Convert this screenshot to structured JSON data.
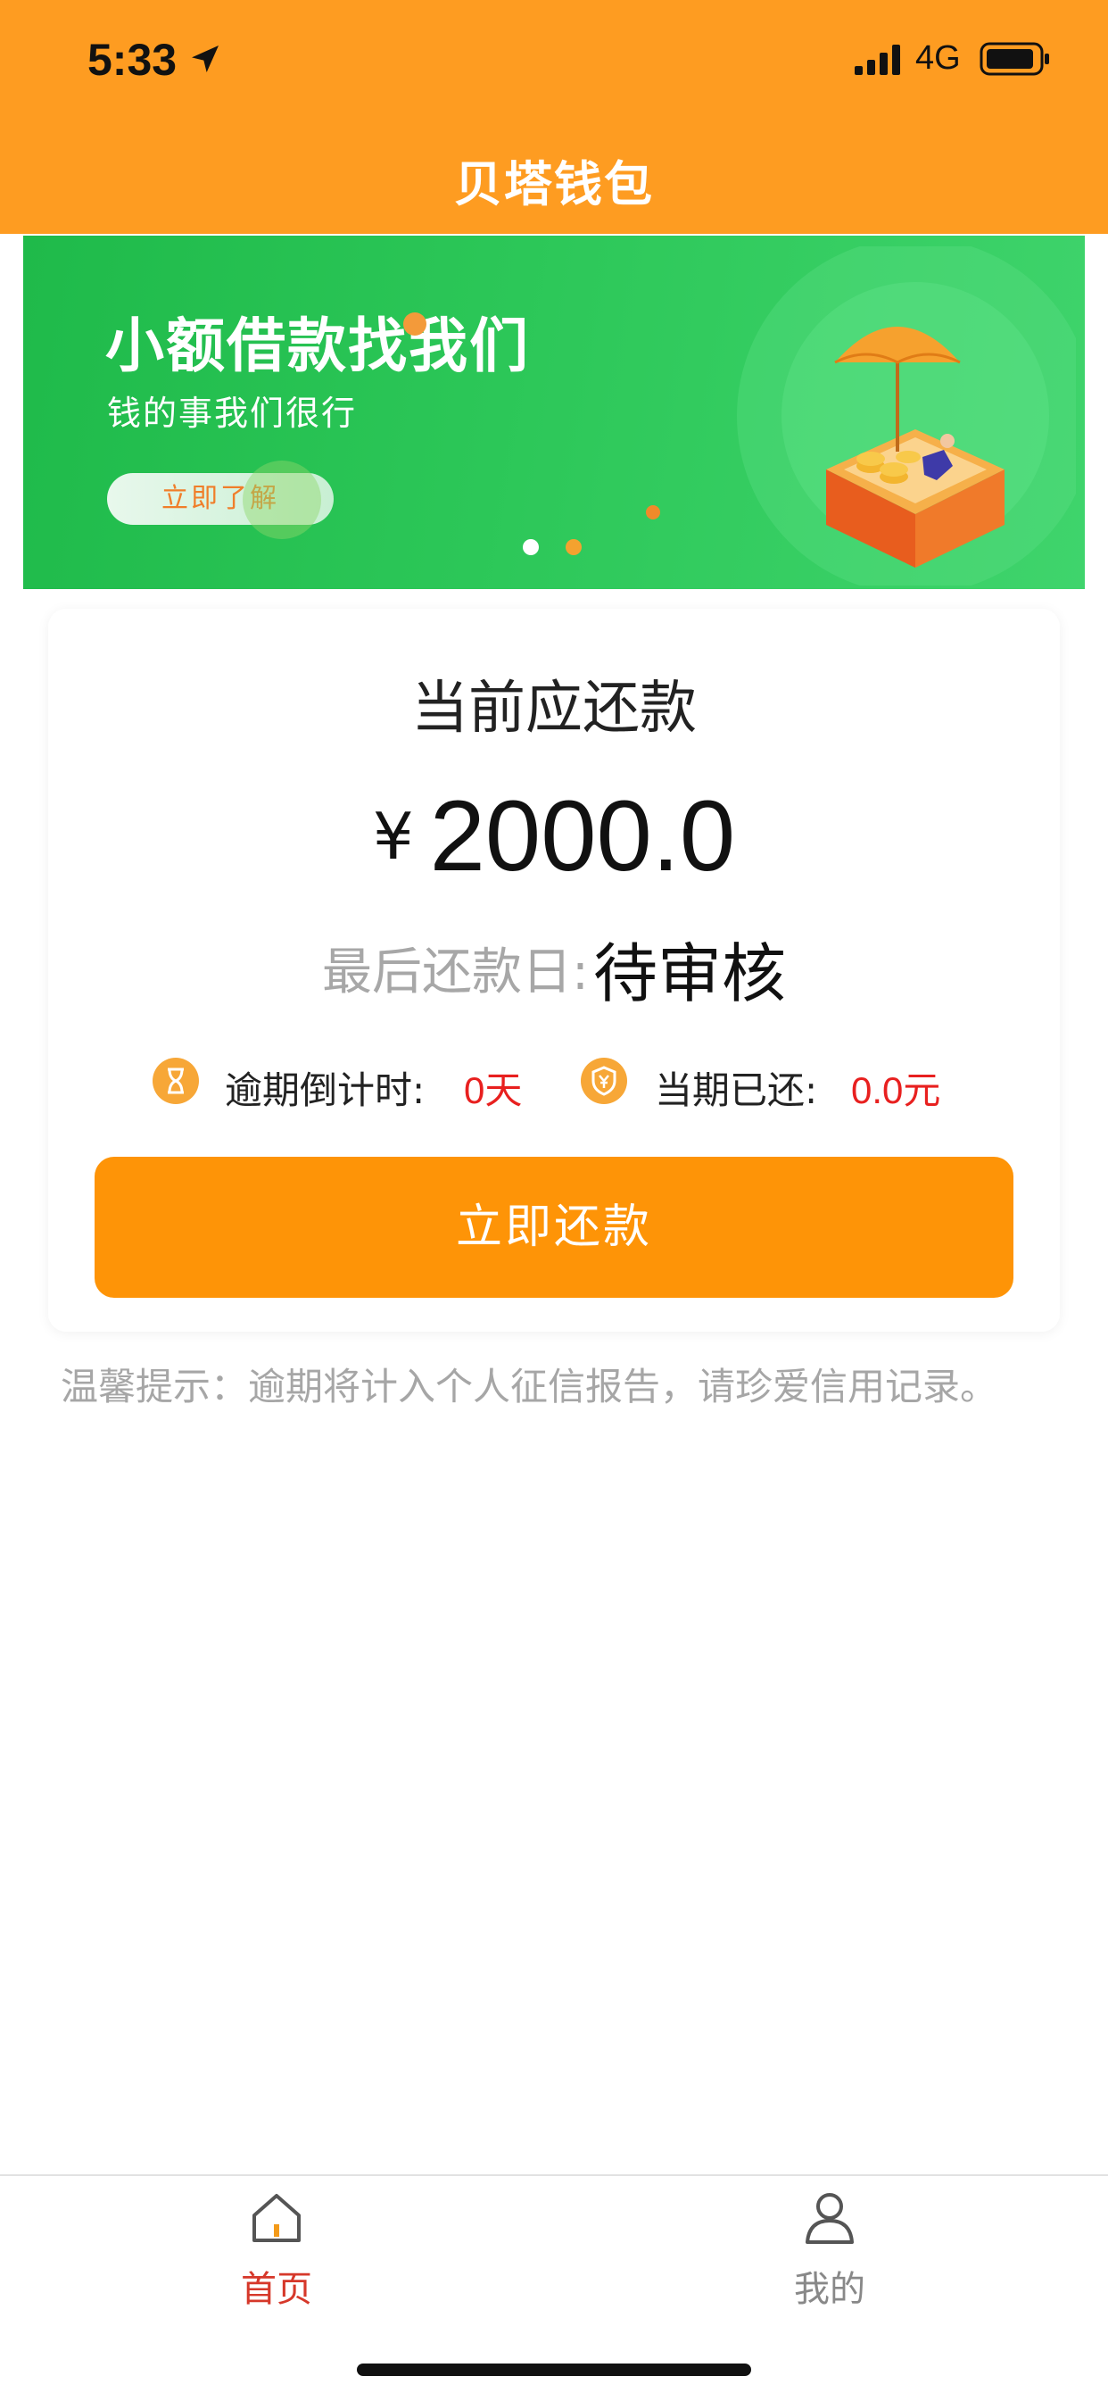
{
  "status_bar": {
    "time": "5:33",
    "network": "4G"
  },
  "nav": {
    "title": "贝塔钱包"
  },
  "banner": {
    "headline": "小额借款找我们",
    "subtitle": "钱的事我们很行",
    "button_label": "立即了解",
    "carousel_active_index": 0,
    "carousel_count": 2
  },
  "repayment_card": {
    "title": "当前应还款",
    "currency_symbol": "¥",
    "amount": "2000.0",
    "due_label": "最后还款日:",
    "due_value": "待审核",
    "overdue_label": "逾期倒计时:",
    "overdue_value": "0天",
    "paid_label": "当期已还:",
    "paid_value": "0.0元",
    "repay_button": "立即还款"
  },
  "tip": "温馨提示：逾期将计入个人征信报告，请珍爱信用记录。",
  "tabbar": {
    "items": [
      {
        "label": "首页",
        "icon": "home-icon",
        "active": true
      },
      {
        "label": "我的",
        "icon": "user-icon",
        "active": false
      }
    ]
  },
  "colors": {
    "brand_orange": "#fe9c21",
    "button_orange": "#fe9407",
    "banner_green": "#2cc758",
    "alert_red": "#e8201f",
    "active_tab": "#d6382a"
  }
}
